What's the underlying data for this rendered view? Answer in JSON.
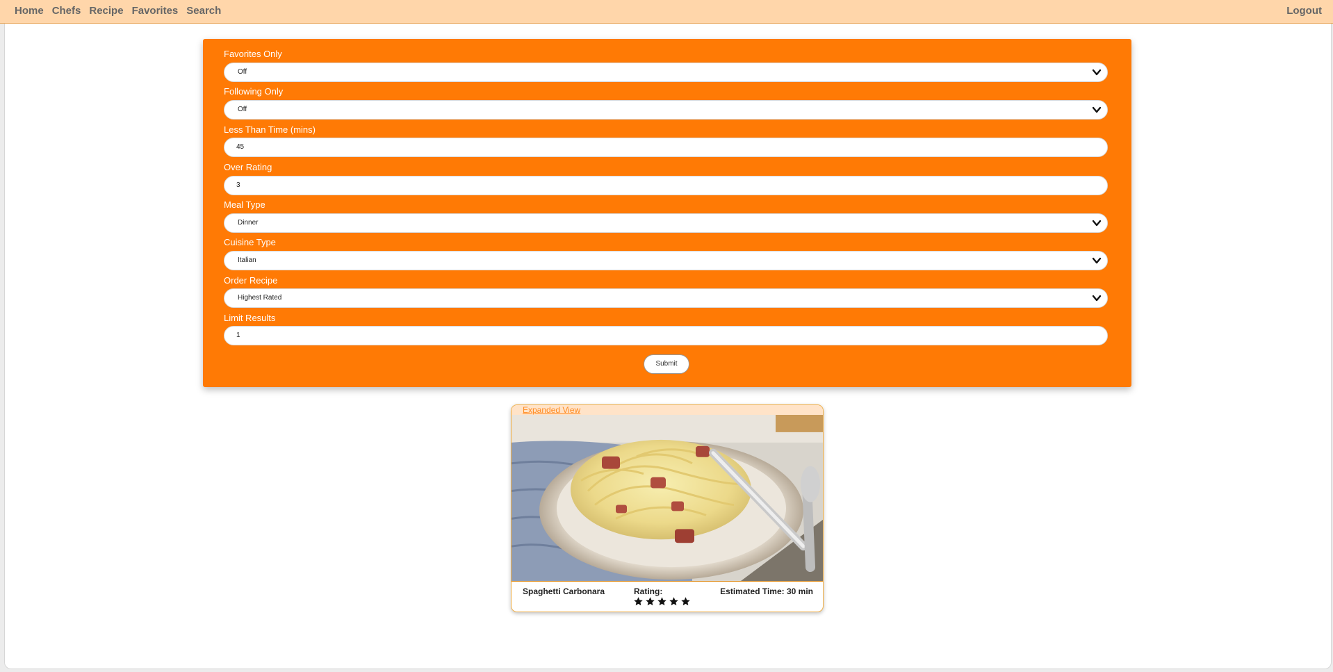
{
  "nav": {
    "links": [
      "Home",
      "Chefs",
      "Recipe",
      "Favorites",
      "Search"
    ],
    "logout": "Logout"
  },
  "form": {
    "favorites_only": {
      "label": "Favorites Only",
      "value": "Off"
    },
    "following_only": {
      "label": "Following Only",
      "value": "Off"
    },
    "less_than_time": {
      "label": "Less Than Time (mins)",
      "value": "45"
    },
    "over_rating": {
      "label": "Over Rating",
      "value": "3"
    },
    "meal_type": {
      "label": "Meal Type",
      "value": "Dinner"
    },
    "cuisine_type": {
      "label": "Cuisine Type",
      "value": "Italian"
    },
    "order_recipe": {
      "label": "Order Recipe",
      "value": "Highest Rated"
    },
    "limit_results": {
      "label": "Limit Results",
      "value": "1"
    },
    "submit": "Submit"
  },
  "result": {
    "expanded_link": "Expanded View",
    "name": "Spaghetti Carbonara",
    "rating_label": "Rating:",
    "rating_stars": 5,
    "estimated_time": "Estimated Time: 30 min"
  },
  "colors": {
    "navbar": "#ffd6aa",
    "panel": "#ff7a05",
    "link": "#ff8a1f"
  }
}
